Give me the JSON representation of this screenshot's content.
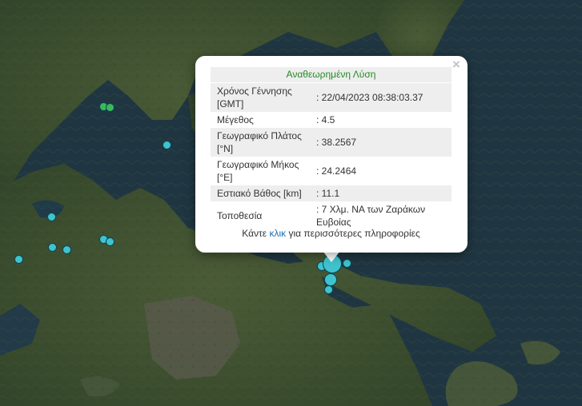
{
  "popup": {
    "title": "Αναθεωρημένη Λύση",
    "close_symbol": "×",
    "rows": [
      {
        "label": "Χρόνος Γέννησης [GMT]",
        "value": ": 22/04/2023 08:38:03.37"
      },
      {
        "label": "Μέγεθος",
        "value": ": 4.5"
      },
      {
        "label": "Γεωγραφικό Πλάτος [°N]",
        "value": ": 38.2567"
      },
      {
        "label": "Γεωγραφικό Μήκος [°E]",
        "value": ": 24.2464"
      },
      {
        "label": "Εστιακό Βάθος [km]",
        "value": ": 11.1"
      },
      {
        "label": "Τοποθεσία",
        "value": ": 7 Χλμ. ΝΑ των Ζαράκων Ευβοίας"
      }
    ],
    "footer_before": "Κάντε ",
    "footer_link": "κλικ",
    "footer_after": " για περισσότερες πληροφορίες"
  },
  "colors": {
    "marker_cyan": "#3fc3cf",
    "marker_green": "#3cb85a",
    "marker_border": "#0e4650",
    "title_green": "#228b22",
    "link_blue": "#1a6fb3"
  },
  "icons": {
    "close": "close-icon"
  }
}
